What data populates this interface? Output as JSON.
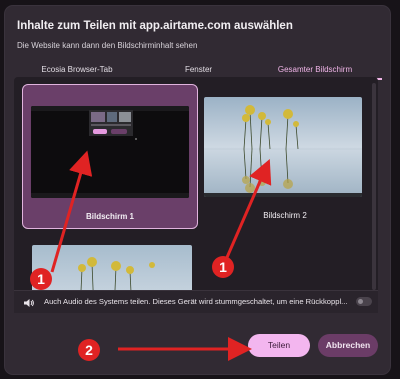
{
  "dialog": {
    "title": "Inhalte zum Teilen mit app.airtame.com auswählen",
    "subtitle": "Die Website kann dann den Bildschirminhalt sehen"
  },
  "tabs": [
    {
      "label": "Ecosia Browser-Tab",
      "selected": false
    },
    {
      "label": "Fenster",
      "selected": false
    },
    {
      "label": "Gesamter Bildschirm",
      "selected": true
    }
  ],
  "screens": [
    {
      "label": "Bildschirm 1",
      "selected": true
    },
    {
      "label": "Bildschirm 2",
      "selected": false
    },
    {
      "label": "",
      "selected": false
    }
  ],
  "audio": {
    "label": "Auch Audio des Systems teilen. Dieses Gerät wird stummgeschaltet, um eine Rückkoppl...",
    "enabled": false,
    "icon": "speaker-icon"
  },
  "buttons": {
    "share": "Teilen",
    "cancel": "Abbrechen"
  },
  "annotations": [
    "1",
    "1",
    "2"
  ],
  "colors": {
    "accent": "#f0b5e8",
    "selected_tile": "#6a3f69",
    "annotation_red": "#e02323"
  }
}
